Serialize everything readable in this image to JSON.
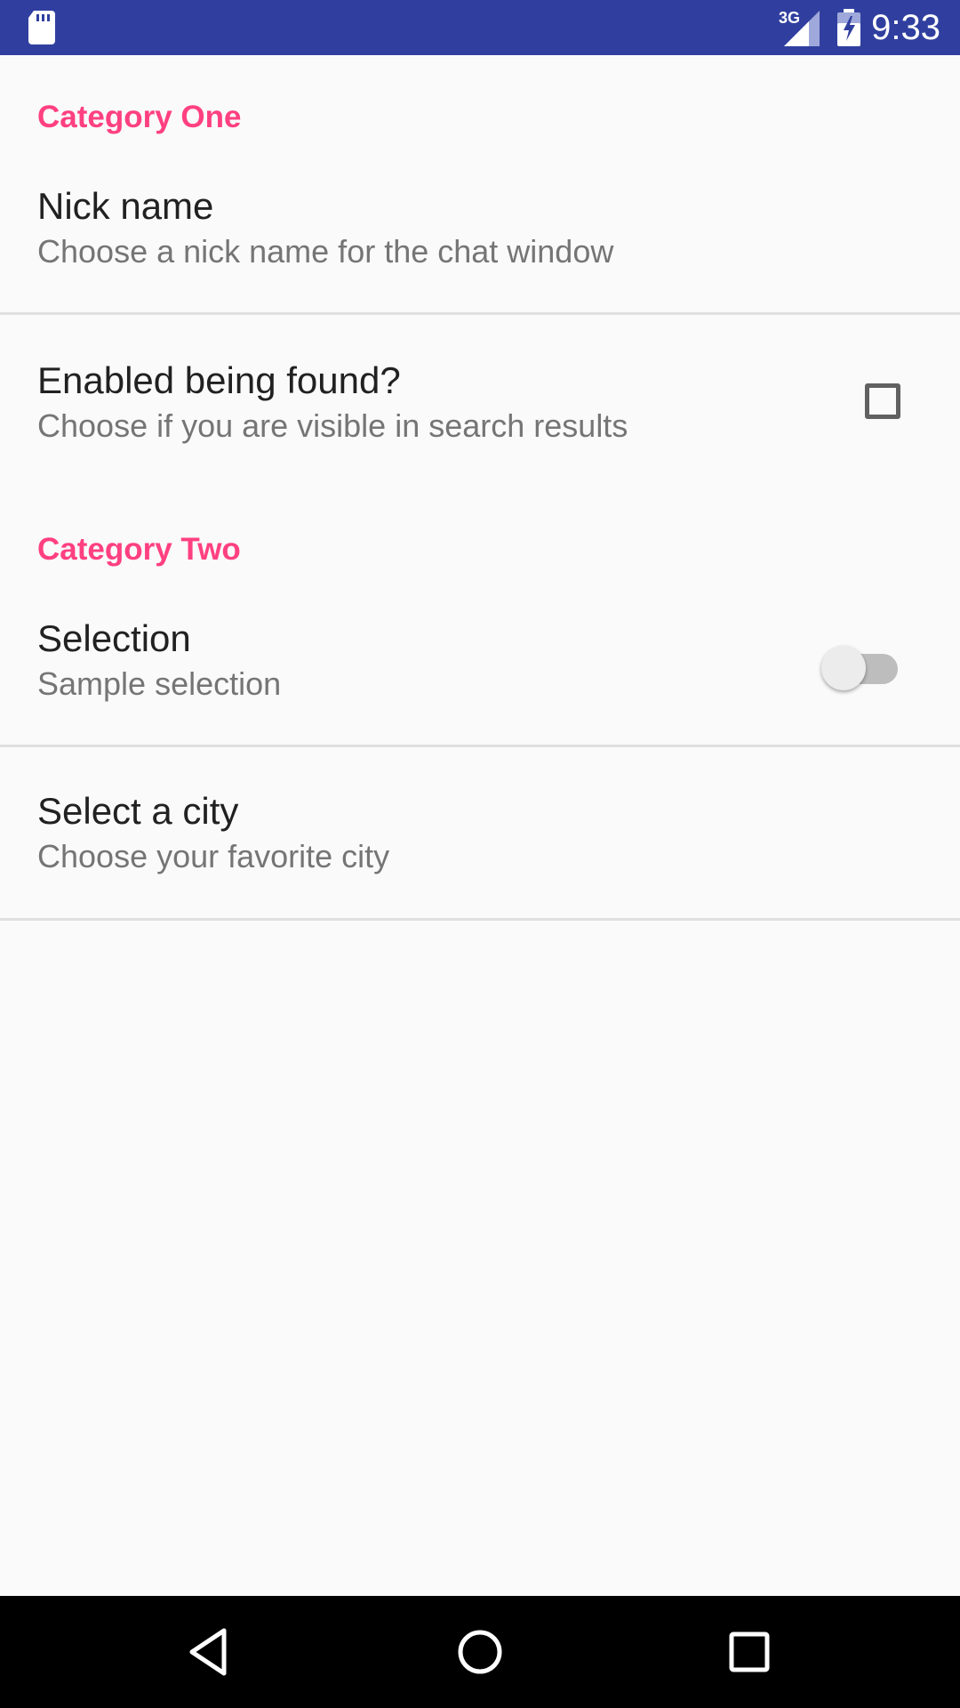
{
  "status_bar": {
    "time": "9:33",
    "network_label": "3G",
    "color": "#303f9f",
    "icons": [
      "sd-card-icon",
      "signal-icon",
      "battery-charging-icon"
    ]
  },
  "preferences": {
    "category_one": {
      "header": "Category One",
      "nick_name": {
        "title": "Nick name",
        "summary": "Choose a nick name for the chat window"
      },
      "enabled_found": {
        "title": "Enabled being found?",
        "summary": "Choose if you are visible in search results",
        "checked": false
      }
    },
    "category_two": {
      "header": "Category Two",
      "selection": {
        "title": "Selection",
        "summary": "Sample selection",
        "on": false
      },
      "city": {
        "title": "Select a city",
        "summary": "Choose your favorite city"
      }
    },
    "accent_color": "#ff4081"
  },
  "nav_bar": {
    "icons": [
      "back-icon",
      "home-icon",
      "recents-icon"
    ]
  }
}
